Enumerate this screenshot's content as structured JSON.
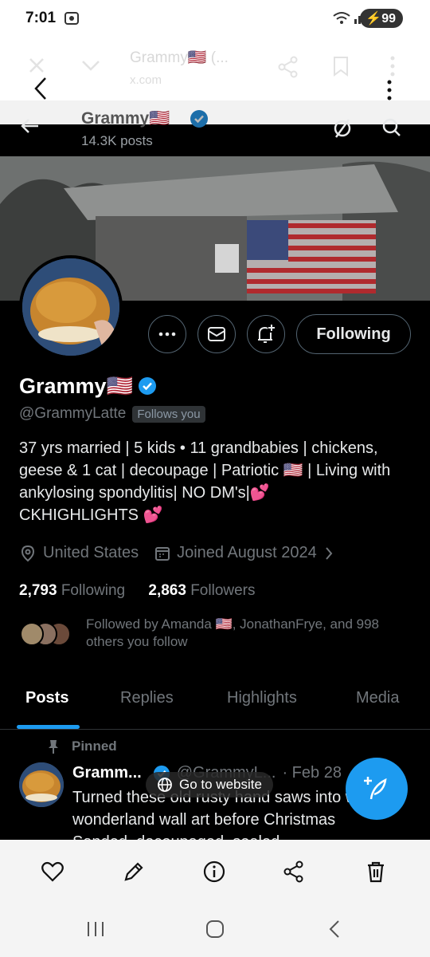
{
  "status_bar": {
    "time": "7:01",
    "battery": "99"
  },
  "browser": {
    "title": "Grammy🇺🇸 (...",
    "url": "x.com"
  },
  "profile": {
    "header_name": "Grammy🇺🇸",
    "posts_count": "14.3K posts",
    "name": "Grammy🇺🇸",
    "handle": "@GrammyLatte",
    "follows_you": "Follows you",
    "bio": "37 yrs married | 5 kids • 11 grandbabies | chickens, geese & 1 cat | decoupage | Patriotic 🇺🇸 | Living with ankylosing spondylitis| NO DM's|💕\nCKHIGHLIGHTS 💕",
    "location": "United States",
    "joined": "Joined August 2024",
    "following_count": "2,793",
    "following_label": "Following",
    "followers_count": "2,863",
    "followers_label": "Followers",
    "followed_by": "Followed by Amanda 🇺🇸, JonathanFrye, and 998 others you follow",
    "following_button": "Following"
  },
  "tabs": [
    "Posts",
    "Replies",
    "Highlights",
    "Media"
  ],
  "pinned_label": "Pinned",
  "tweet": {
    "name": "Gramm...",
    "handle": "@GrammyL...",
    "date": "· Feb 28",
    "text": "Turned these old rusty hand saws into winter wonderland wall art before Christmas Sanded, decoupaged, sealed"
  },
  "go_to_website": "Go to website",
  "colors": {
    "accent": "#1d9bf0",
    "background": "#000000"
  },
  "toolbar_icons": [
    "heart-icon",
    "edit-icon",
    "info-icon",
    "share-icon",
    "trash-icon"
  ]
}
